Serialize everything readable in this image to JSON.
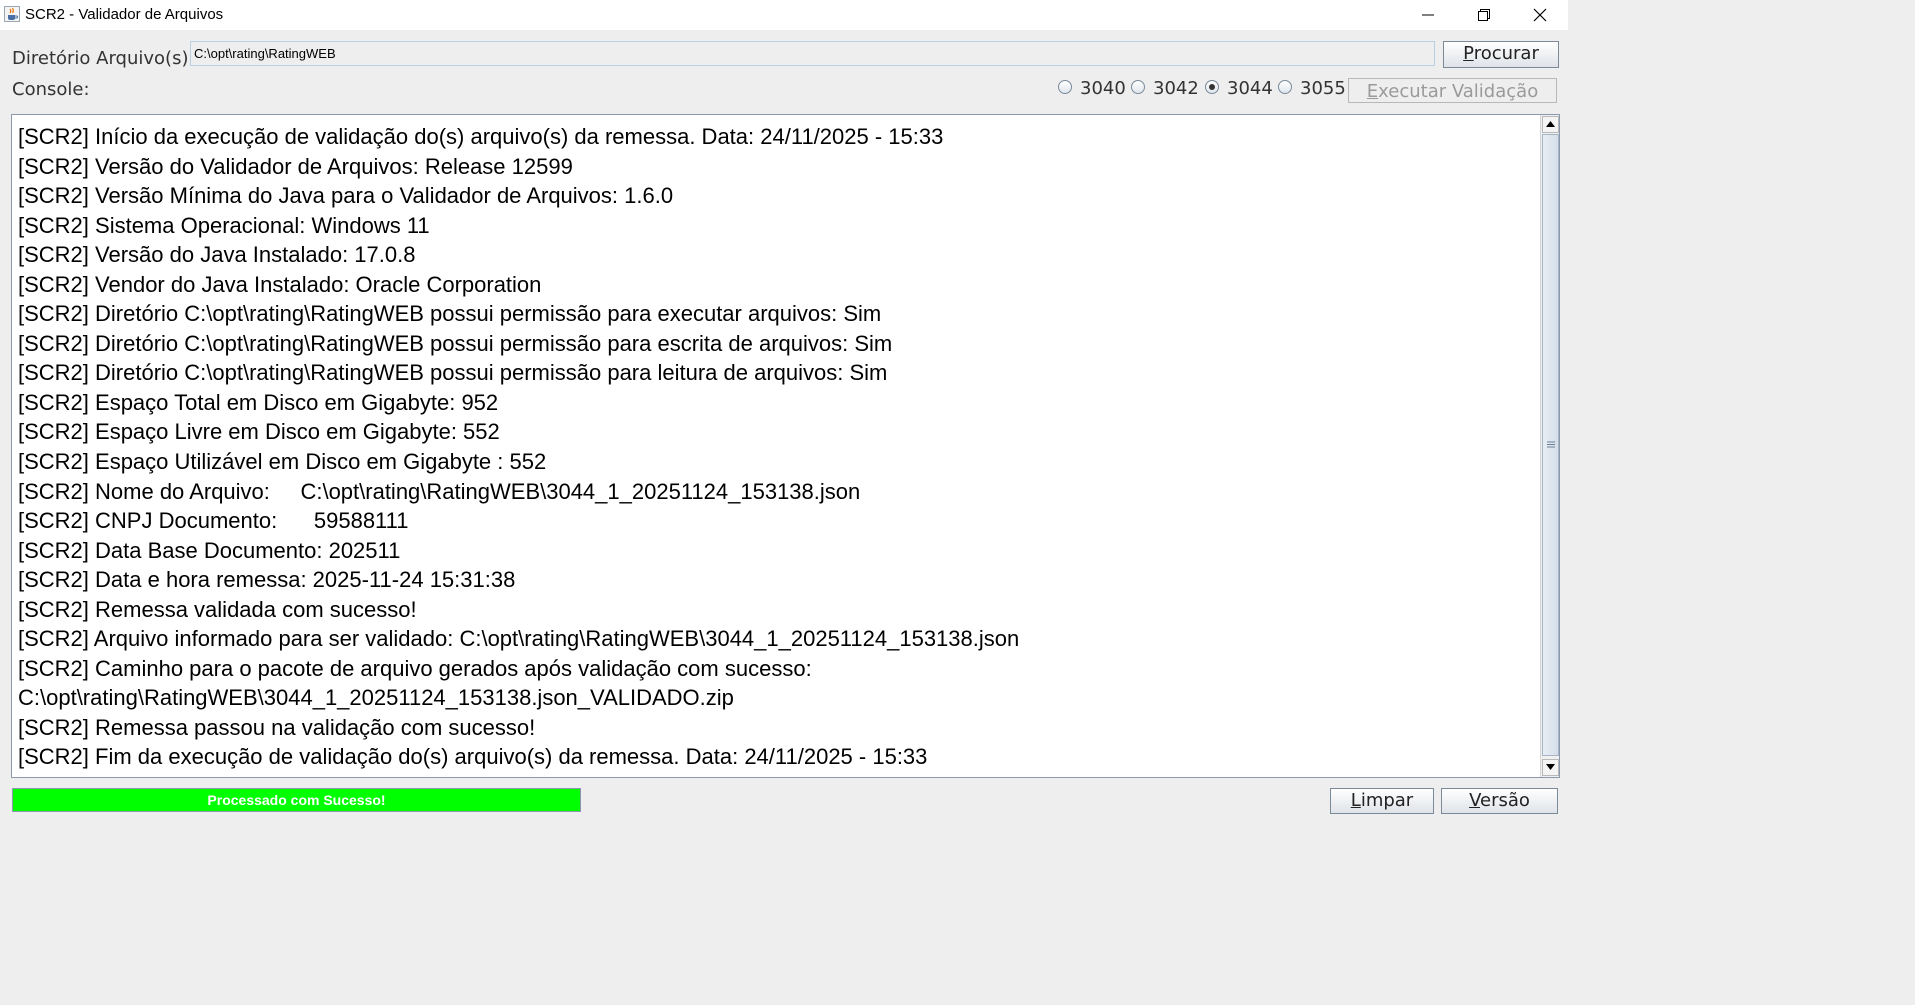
{
  "window": {
    "title": "SCR2 - Validador de Arquivos"
  },
  "directory": {
    "label": "Diretório Arquivo(s):",
    "value": "C:\\opt\\rating\\RatingWEB",
    "browse_label_mnemonic": "P",
    "browse_label_rest": "rocurar"
  },
  "console": {
    "label": "Console:",
    "versions": [
      {
        "label": "3040",
        "selected": false
      },
      {
        "label": "3042",
        "selected": false
      },
      {
        "label": "3044",
        "selected": true
      },
      {
        "label": "3055",
        "selected": false
      }
    ],
    "execute_label_mnemonic": "E",
    "execute_label_rest": "xecutar Validação",
    "execute_enabled": false,
    "lines": [
      "[SCR2] Início da execução de validação do(s) arquivo(s) da remessa. Data: 24/11/2025 - 15:33",
      "[SCR2] Versão do Validador de Arquivos: Release 12599",
      "[SCR2] Versão Mínima do Java para o Validador de Arquivos: 1.6.0",
      "[SCR2] Sistema Operacional: Windows 11",
      "[SCR2] Versão do Java Instalado: 17.0.8",
      "[SCR2] Vendor do Java Instalado: Oracle Corporation",
      "[SCR2] Diretório C:\\opt\\rating\\RatingWEB possui permissão para executar arquivos: Sim",
      "[SCR2] Diretório C:\\opt\\rating\\RatingWEB possui permissão para escrita de arquivos: Sim",
      "[SCR2] Diretório C:\\opt\\rating\\RatingWEB possui permissão para leitura de arquivos: Sim",
      "[SCR2] Espaço Total em Disco em Gigabyte: 952",
      "[SCR2] Espaço Livre em Disco em Gigabyte: 552",
      "[SCR2] Espaço Utilizável em Disco em Gigabyte : 552",
      "[SCR2] Nome do Arquivo:     C:\\opt\\rating\\RatingWEB\\3044_1_20251124_153138.json",
      "[SCR2] CNPJ Documento:      59588111",
      "[SCR2] Data Base Documento: 202511",
      "[SCR2] Data e hora remessa: 2025-11-24 15:31:38",
      "[SCR2] Remessa validada com sucesso!",
      "[SCR2] Arquivo informado para ser validado: C:\\opt\\rating\\RatingWEB\\3044_1_20251124_153138.json",
      "[SCR2] Caminho para o pacote de arquivo gerados após validação com sucesso:",
      "C:\\opt\\rating\\RatingWEB\\3044_1_20251124_153138.json_VALIDADO.zip",
      "[SCR2] Remessa passou na validação com sucesso!",
      "[SCR2] Fim da execução de validação do(s) arquivo(s) da remessa. Data: 24/11/2025 - 15:33"
    ]
  },
  "progress": {
    "text": "Processado com Sucesso!",
    "percent": 100,
    "color": "#00ff00"
  },
  "footer": {
    "clear_label_mnemonic": "L",
    "clear_label_rest": "impar",
    "version_label_mnemonic": "V",
    "version_label_rest": "ersão"
  }
}
